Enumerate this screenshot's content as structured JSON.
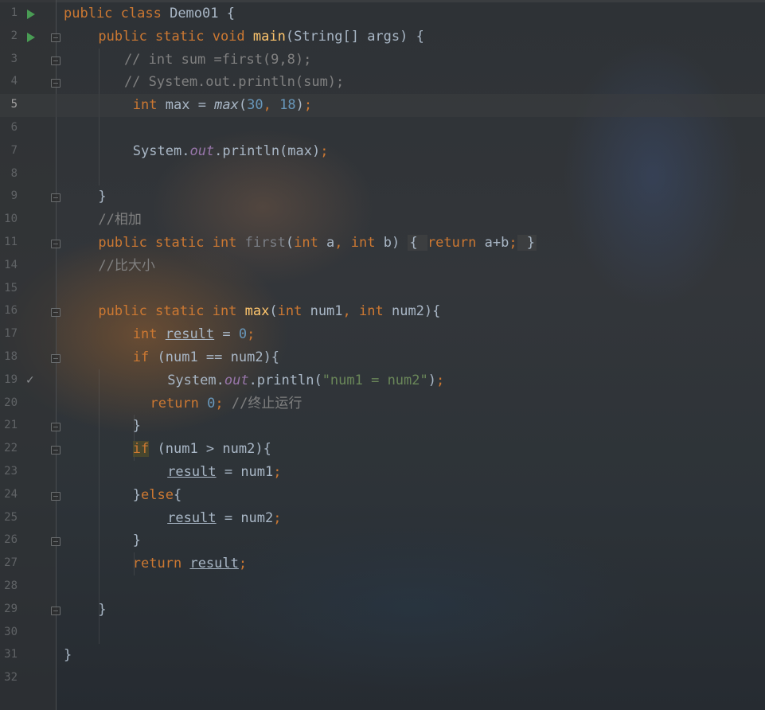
{
  "editor": {
    "lines": [
      {
        "n": "1",
        "indent": 0,
        "tokens": [
          [
            "kw",
            "public "
          ],
          [
            "kw",
            "class "
          ],
          [
            "",
            "Demo01 {"
          ]
        ]
      },
      {
        "n": "2",
        "indent": 1,
        "tokens": [
          [
            "kw",
            "public "
          ],
          [
            "kw",
            "static "
          ],
          [
            "kw",
            "void "
          ],
          [
            "fn",
            "main"
          ],
          [
            "",
            "(String[] args) {"
          ]
        ]
      },
      {
        "n": "3",
        "indent": 1.75,
        "tokens": [
          [
            "cm",
            "// int sum =first(9,8);"
          ]
        ]
      },
      {
        "n": "4",
        "indent": 1.75,
        "tokens": [
          [
            "cm",
            "// System.out.println(sum);"
          ]
        ]
      },
      {
        "n": "5",
        "indent": 2,
        "tokens": [
          [
            "kw",
            "int "
          ],
          [
            "",
            "max = "
          ],
          [
            "it",
            "max"
          ],
          [
            "",
            "("
          ],
          [
            "num",
            "30"
          ],
          [
            "kw",
            ", "
          ],
          [
            "num",
            "18"
          ],
          [
            "",
            ")"
          ],
          [
            "kw",
            ";"
          ]
        ]
      },
      {
        "n": "6",
        "indent": 0,
        "tokens": []
      },
      {
        "n": "7",
        "indent": 2,
        "tokens": [
          [
            "",
            "System."
          ],
          [
            "fld",
            "out"
          ],
          [
            "",
            ".println(max)"
          ],
          [
            "kw",
            ";"
          ]
        ]
      },
      {
        "n": "8",
        "indent": 0,
        "tokens": []
      },
      {
        "n": "9",
        "indent": 1,
        "tokens": [
          [
            "",
            "}"
          ]
        ]
      },
      {
        "n": "10",
        "indent": 1,
        "tokens": [
          [
            "cm",
            "//相加"
          ]
        ]
      },
      {
        "n": "11",
        "indent": 1,
        "tokens": [
          [
            "kw",
            "public "
          ],
          [
            "kw",
            "static "
          ],
          [
            "kw",
            "int "
          ],
          [
            "dim",
            "first"
          ],
          [
            "",
            "("
          ],
          [
            "kw",
            "int "
          ],
          [
            "",
            "a"
          ],
          [
            "kw",
            ", "
          ],
          [
            "kw",
            "int "
          ],
          [
            "",
            "b) "
          ],
          [
            "fold",
            "{ "
          ],
          [
            "kw",
            "return "
          ],
          [
            "",
            "a+b"
          ],
          [
            "kw",
            ";"
          ],
          [
            "fold",
            " }"
          ]
        ]
      },
      {
        "n": "14",
        "indent": 1,
        "tokens": [
          [
            "cm",
            "//比大小"
          ]
        ]
      },
      {
        "n": "15",
        "indent": 0,
        "tokens": []
      },
      {
        "n": "16",
        "indent": 1,
        "tokens": [
          [
            "kw",
            "public "
          ],
          [
            "kw",
            "static "
          ],
          [
            "kw",
            "int "
          ],
          [
            "fn",
            "max"
          ],
          [
            "",
            "("
          ],
          [
            "kw",
            "int "
          ],
          [
            "",
            "num1"
          ],
          [
            "kw",
            ", "
          ],
          [
            "kw",
            "int "
          ],
          [
            "",
            "num2){"
          ]
        ]
      },
      {
        "n": "17",
        "indent": 2,
        "tokens": [
          [
            "kw",
            "int "
          ],
          [
            "ul",
            "result"
          ],
          [
            "",
            " = "
          ],
          [
            "num",
            "0"
          ],
          [
            "kw",
            ";"
          ]
        ]
      },
      {
        "n": "18",
        "indent": 2,
        "tokens": [
          [
            "kw",
            "if "
          ],
          [
            "",
            "(num1 == num2){"
          ]
        ]
      },
      {
        "n": "19",
        "indent": 3,
        "tokens": [
          [
            "",
            "System."
          ],
          [
            "fld",
            "out"
          ],
          [
            "",
            ".println("
          ],
          [
            "str",
            "\"num1 = num2\""
          ],
          [
            "",
            ")"
          ],
          [
            "kw",
            ";"
          ]
        ]
      },
      {
        "n": "20",
        "indent": 2.5,
        "tokens": [
          [
            "kw",
            "return "
          ],
          [
            "num",
            "0"
          ],
          [
            "kw",
            "; "
          ],
          [
            "cm",
            "//终止运行"
          ]
        ]
      },
      {
        "n": "21",
        "indent": 2,
        "tokens": [
          [
            "",
            "}"
          ]
        ]
      },
      {
        "n": "22",
        "indent": 2,
        "tokens": [
          [
            "kwhl",
            "if"
          ],
          [
            "",
            " (num1 > num2){"
          ]
        ]
      },
      {
        "n": "23",
        "indent": 3,
        "tokens": [
          [
            "ul",
            "result"
          ],
          [
            "",
            " = num1"
          ],
          [
            "kw",
            ";"
          ]
        ]
      },
      {
        "n": "24",
        "indent": 2,
        "tokens": [
          [
            "",
            "}"
          ],
          [
            "kw",
            "else"
          ],
          [
            "",
            "{"
          ]
        ]
      },
      {
        "n": "25",
        "indent": 3,
        "tokens": [
          [
            "ul",
            "result"
          ],
          [
            "",
            " = num2"
          ],
          [
            "kw",
            ";"
          ]
        ]
      },
      {
        "n": "26",
        "indent": 2,
        "tokens": [
          [
            "",
            "}"
          ]
        ]
      },
      {
        "n": "27",
        "indent": 2,
        "tokens": [
          [
            "kw",
            "return "
          ],
          [
            "ul",
            "result"
          ],
          [
            "kw",
            ";"
          ]
        ]
      },
      {
        "n": "28",
        "indent": 0,
        "tokens": []
      },
      {
        "n": "29",
        "indent": 1,
        "tokens": [
          [
            "",
            "}"
          ]
        ]
      },
      {
        "n": "30",
        "indent": 0,
        "tokens": []
      },
      {
        "n": "31",
        "indent": 0,
        "tokens": [
          [
            "",
            "}"
          ]
        ]
      },
      {
        "n": "32",
        "indent": 0,
        "tokens": []
      }
    ],
    "current_line": "5",
    "run_lines": [
      "1",
      "2"
    ],
    "check_lines": [
      "19"
    ],
    "fold_lines": [
      "2",
      "3",
      "4",
      "9",
      "11",
      "16",
      "18",
      "21",
      "22",
      "24",
      "26",
      "29"
    ]
  },
  "colors": {
    "keyword": "#cc7832",
    "function": "#ffc66d",
    "number": "#6897bb",
    "comment": "#808080",
    "string": "#6a8759",
    "field": "#9876aa",
    "text": "#a9b7c6"
  }
}
